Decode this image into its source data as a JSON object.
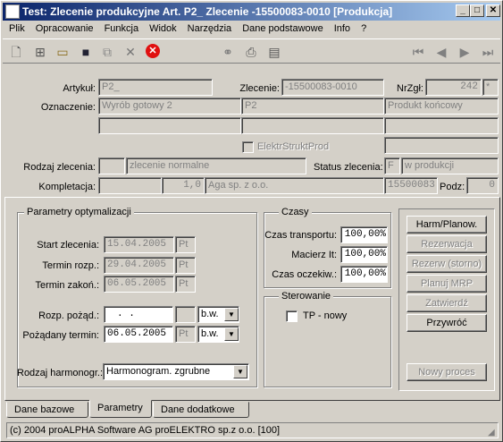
{
  "title": "Test: Zlecenie produkcyjne Art. P2_ Zlecenie -15500083-0010  [Produkcja]",
  "window_buttons": {
    "minimize": "_",
    "maximize": "□",
    "close": "✕"
  },
  "menu": [
    "Plik",
    "Opracowanie",
    "Funkcja",
    "Widok",
    "Narzędzia",
    "Dane podstawowe",
    "Info",
    "?"
  ],
  "toolbar_icons": [
    "new-icon",
    "tree-icon",
    "open-icon",
    "save-icon",
    "copy-icon",
    "delete-icon",
    "cancel-icon",
    "link-icon",
    "print-icon",
    "export-icon",
    "first-icon",
    "prev-icon",
    "next-icon",
    "last-icon"
  ],
  "header": {
    "artykul_label": "Artykuł:",
    "artykul_value": "P2_",
    "zlecenie_label": "Zlecenie:",
    "zlecenie_value": "-15500083-0010",
    "nrzgl_label": "NrZgł:",
    "nrzgl_value": "242",
    "nrzgl_flag": "*",
    "oznaczenie_label": "Oznaczenie:",
    "oznaczenie_1": "Wyrób gotowy 2",
    "oznaczenie_2": "P2",
    "oznaczenie_3": "Produkt końcowy",
    "elektr_label": "ElektrStruktProd",
    "rodzaj_label": "Rodzaj zlecenia:",
    "rodzaj_value": "zlecenie normalne",
    "status_label": "Status zlecenia:",
    "status_code": "F",
    "status_value": "w produkcji",
    "kompletacja_label": "Kompletacja:",
    "kompletacja_num": "1,0",
    "kompletacja_firm": "Aga sp. z o.o.",
    "kompletacja_id": "15500083",
    "podz_label": "Podz:",
    "podz_value": "0"
  },
  "params": {
    "group_title": "Parametry optymalizacji",
    "start_label": "Start zlecenia:",
    "start_value": "15.04.2005",
    "start_day": "Pt",
    "termin_rozp_label": "Termin rozp.:",
    "termin_rozp_value": "29.04.2005",
    "termin_rozp_day": "Pt",
    "termin_zakon_label": "Termin zakoń.:",
    "termin_zakon_value": "06.05.2005",
    "termin_zakon_day": "Pt",
    "rozp_pozad_label": "Rozp. pożąd.:",
    "rozp_pozad_value": ". .",
    "rozp_pozad_mode": "b.w.",
    "pozadany_label": "Pożądany termin:",
    "pozadany_value": "06.05.2005",
    "pozadany_day": "Pt",
    "pozadany_mode": "b.w.",
    "harmonogr_label": "Rodzaj harmonogr.:",
    "harmonogr_value": "Harmonogram. zgrubne"
  },
  "czasy": {
    "group_title": "Czasy",
    "transport_label": "Czas transportu:",
    "transport_value": "100,00%",
    "macierz_label": "Macierz It:",
    "macierz_value": "100,00%",
    "oczekiw_label": "Czas oczekiw.:",
    "oczekiw_value": "100,00%"
  },
  "sterowanie": {
    "group_title": "Sterowanie",
    "tp_label": "TP - nowy"
  },
  "buttons": {
    "harm": "Harm/Planow.",
    "rezerwacja": "Rezerwacja",
    "rezerw_storno": "Rezerw (storno)",
    "planuj": "Planuj MRP",
    "zatwierdz": "Zatwierdź",
    "przywroc": "Przywróć",
    "nowy_proces": "Nowy proces"
  },
  "tabs": [
    "Dane bazowe",
    "Parametry",
    "Dane dodatkowe"
  ],
  "status_bar": "(c) 2004 proALPHA Software AG  proELEKTRO sp.z o.o. [100]"
}
